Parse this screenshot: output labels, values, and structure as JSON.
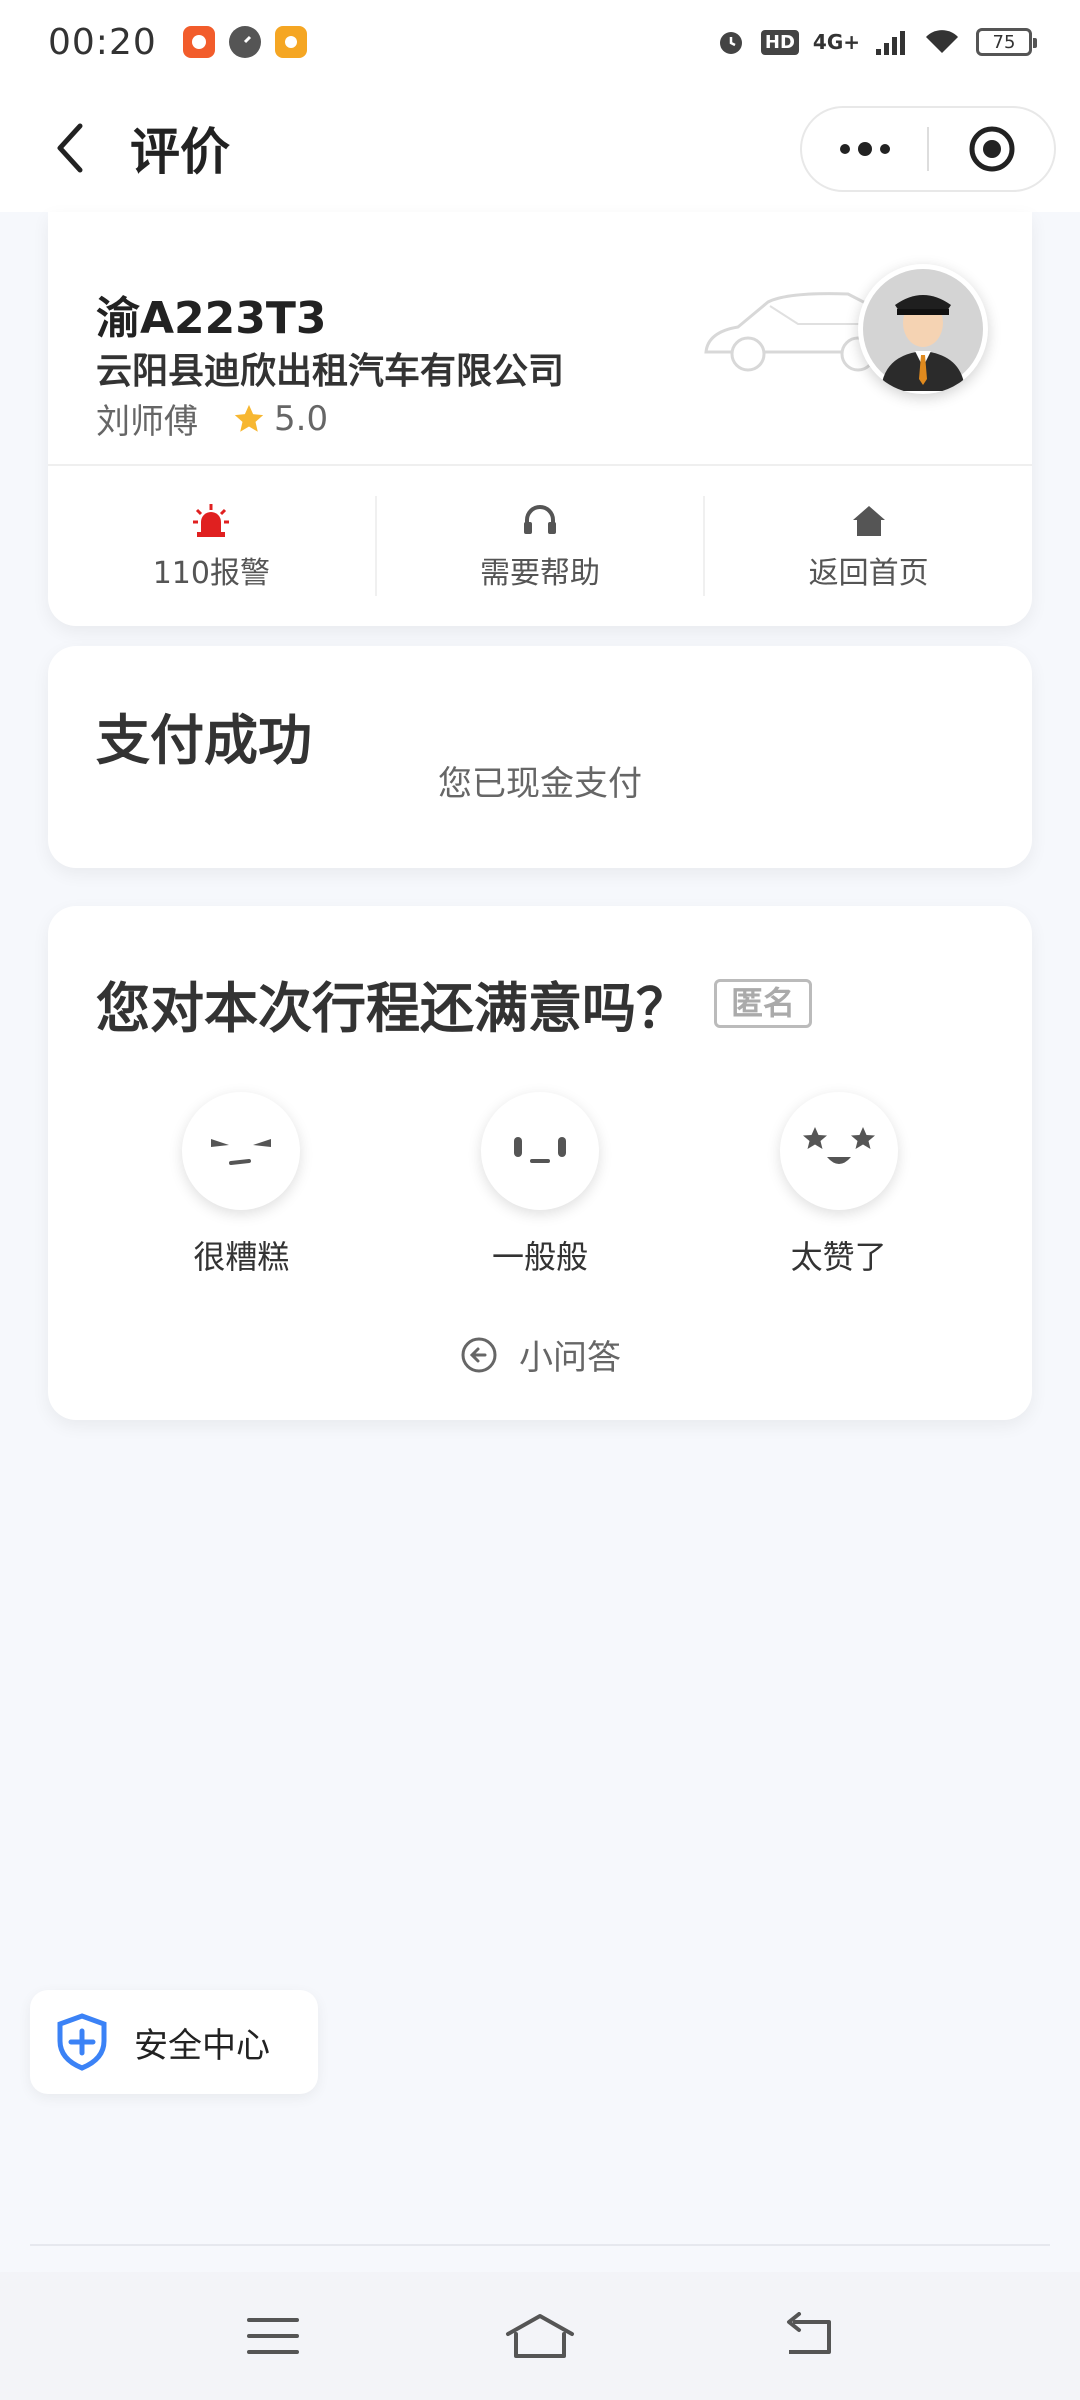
{
  "status_bar": {
    "time": "00:20",
    "hd_label": "HD",
    "network_label": "4G+",
    "battery": "75"
  },
  "header": {
    "title": "评价"
  },
  "driver_card": {
    "plate": "渝A223T3",
    "company": "云阳县迪欣出租汽车有限公司",
    "driver_name": "刘师傅",
    "rating": "5.0",
    "actions": [
      {
        "label": "110报警",
        "icon": "alarm-icon",
        "color": "#e02020"
      },
      {
        "label": "需要帮助",
        "icon": "headset-icon",
        "color": "#555555"
      },
      {
        "label": "返回首页",
        "icon": "home-icon",
        "color": "#555555"
      }
    ]
  },
  "payment_card": {
    "title": "支付成功",
    "subtitle": "您已现金支付"
  },
  "rating_card": {
    "question": "您对本次行程还满意吗？",
    "anonymous_tag": "匿名",
    "options": [
      {
        "label": "很糟糕",
        "icon": "angry-face-icon"
      },
      {
        "label": "一般般",
        "icon": "neutral-face-icon"
      },
      {
        "label": "太赞了",
        "icon": "star-eyes-face-icon"
      }
    ],
    "qa_link": "小问答"
  },
  "safety_center": {
    "label": "安全中心",
    "color": "#3b82f6"
  },
  "colors": {
    "star": "#f7b731",
    "alarm": "#e02020"
  }
}
